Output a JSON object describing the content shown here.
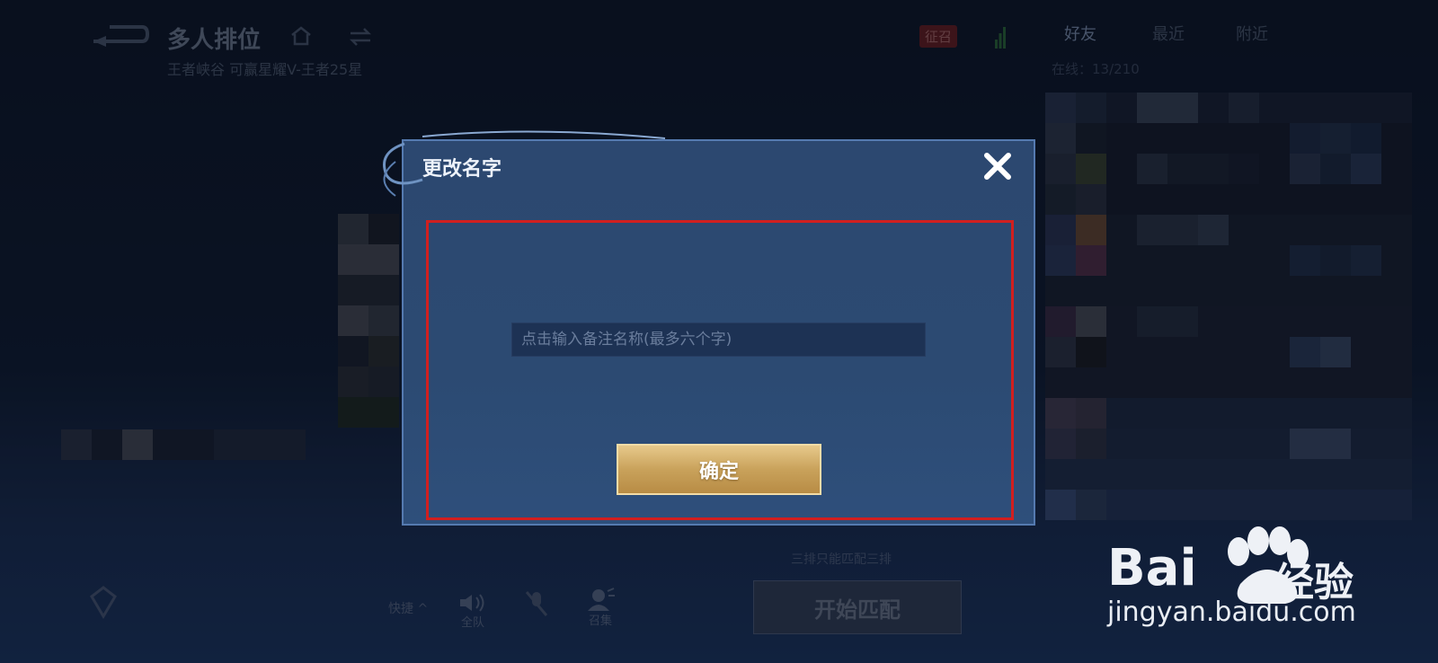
{
  "header": {
    "title": "多人排位",
    "subtitle": "王者峡谷 可赢星耀V-王者25星",
    "recruit_label": "征召",
    "tabs": [
      {
        "label": "好友",
        "active": true
      },
      {
        "label": "最近",
        "active": false
      },
      {
        "label": "附近",
        "active": false
      }
    ],
    "online_label": "在线：13/210"
  },
  "dialog": {
    "title": "更改名字",
    "input_placeholder": "点击输入备注名称(最多六个字)",
    "input_value": "",
    "confirm_label": "确定",
    "close_icon": "close-icon"
  },
  "bottom_bar": {
    "rank_hint": "三排只能匹配三排",
    "start_label": "开始匹配",
    "quick_label": "快捷 ^",
    "team_voice_label": "全队",
    "summon_label": "召集"
  },
  "watermark": {
    "brand": "Bai",
    "brand_suffix": "经验",
    "url": "jingyan.baidu.com"
  },
  "colors": {
    "dialog_bg": "#2c4870",
    "highlight_border": "#d11f1f",
    "confirm_gold": "#c9a25b"
  }
}
